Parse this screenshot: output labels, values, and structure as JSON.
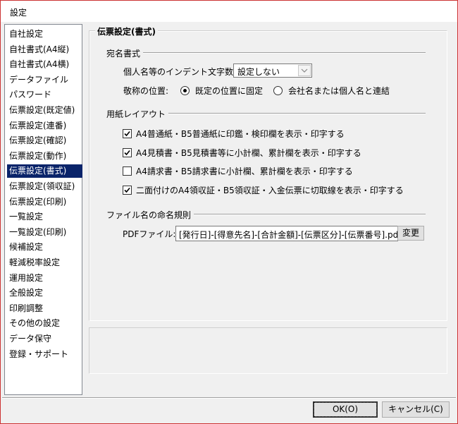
{
  "window": {
    "title": "設定"
  },
  "sidebar": {
    "items": [
      {
        "label": "自社設定"
      },
      {
        "label": "自社書式(A4縦)"
      },
      {
        "label": "自社書式(A4横)"
      },
      {
        "label": "データファイル"
      },
      {
        "label": "パスワード"
      },
      {
        "label": "伝票設定(既定値)"
      },
      {
        "label": "伝票設定(連番)"
      },
      {
        "label": "伝票設定(確認)"
      },
      {
        "label": "伝票設定(動作)"
      },
      {
        "label": "伝票設定(書式)",
        "selected": true
      },
      {
        "label": "伝票設定(領収証)"
      },
      {
        "label": "伝票設定(印刷)"
      },
      {
        "label": "一覧設定"
      },
      {
        "label": "一覧設定(印刷)"
      },
      {
        "label": "候補設定"
      },
      {
        "label": "軽減税率設定"
      },
      {
        "label": "運用設定"
      },
      {
        "label": "全般設定"
      },
      {
        "label": "印刷調整"
      },
      {
        "label": "その他の設定"
      },
      {
        "label": "データ保守"
      },
      {
        "label": "登録・サポート"
      }
    ]
  },
  "main": {
    "group_title": "伝票設定(書式)",
    "address": {
      "section_label": "宛名書式",
      "indent_label": "個人名等のインデント文字数:",
      "indent_value": "設定しない",
      "honorific_label": "敬称の位置:",
      "radio_default": "既定の位置に固定",
      "radio_company": "会社名または個人名と連結",
      "selected_radio": "default"
    },
    "paper": {
      "section_label": "用紙レイアウト",
      "options": [
        {
          "label": "A4普通紙・B5普通紙に印鑑・検印欄を表示・印字する",
          "checked": true
        },
        {
          "label": "A4見積書・B5見積書等に小計欄、累計欄を表示・印字する",
          "checked": true
        },
        {
          "label": "A4請求書・B5請求書に小計欄、累計欄を表示・印字する",
          "checked": false
        },
        {
          "label": "二面付けのA4領収証・B5領収証・入金伝票に切取線を表示・印字する",
          "checked": true
        }
      ]
    },
    "filename": {
      "section_label": "ファイル名の命名規則",
      "pdf_label": "PDFファイル:",
      "pdf_value": "[発行日]-[得意先名]-[合計金額]-[伝票区分]-[伝票番号].pdf",
      "change_button": "変更"
    }
  },
  "footer": {
    "ok_button": "OK(O)",
    "cancel_button": "キャンセル(C)"
  }
}
